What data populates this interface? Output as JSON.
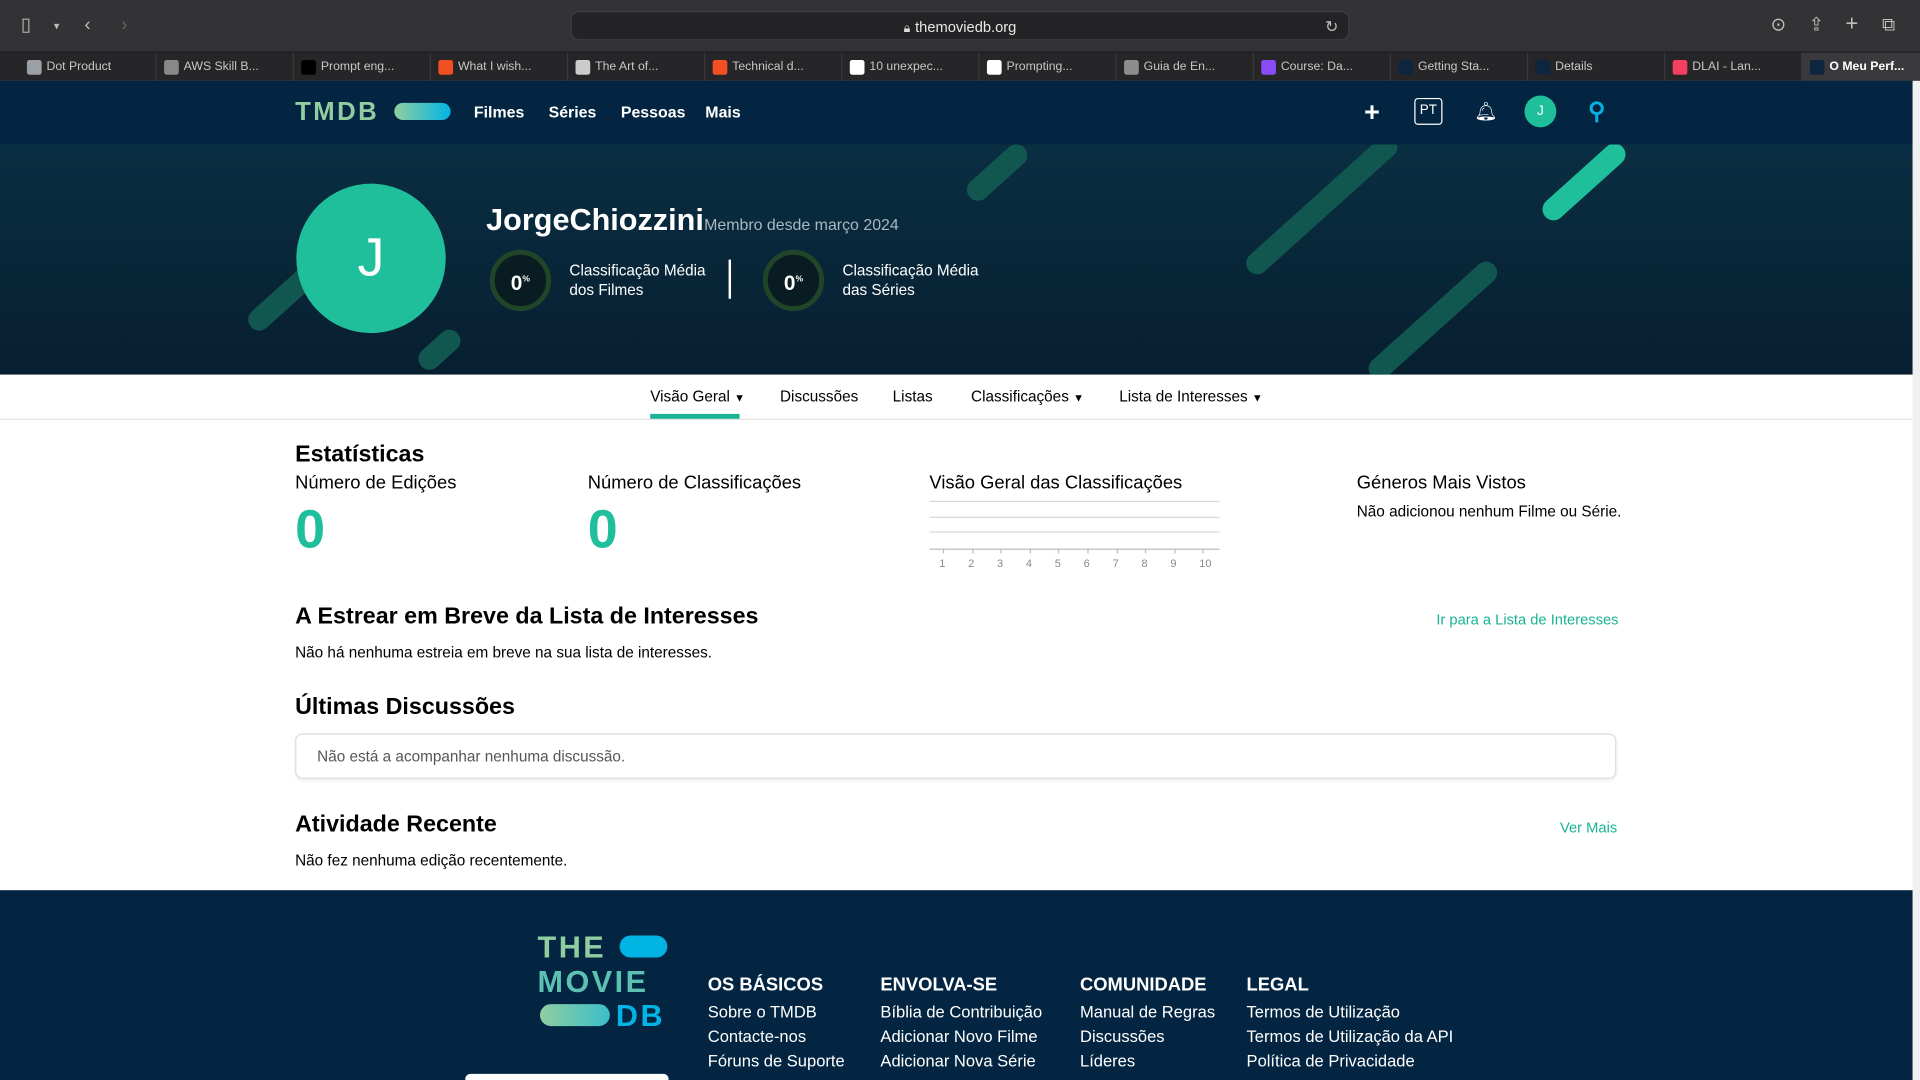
{
  "browser": {
    "url": "themoviedb.org",
    "tabs": [
      {
        "label": "Dot Product",
        "color": "#9aa0a6"
      },
      {
        "label": "AWS Skill B...",
        "color": "#888888"
      },
      {
        "label": "Prompt eng...",
        "color": "#000000"
      },
      {
        "label": "What I wish...",
        "color": "#f25022"
      },
      {
        "label": "The Art of...",
        "color": "#cccccc"
      },
      {
        "label": "Technical d...",
        "color": "#f25022"
      },
      {
        "label": "10 unexpec...",
        "color": "#ffffff"
      },
      {
        "label": "Prompting...",
        "color": "#ffffff"
      },
      {
        "label": "Guia de En...",
        "color": "#8d8d8d"
      },
      {
        "label": "Course: Da...",
        "color": "#8a4cf7"
      },
      {
        "label": "Getting Sta...",
        "color": "#0d253f"
      },
      {
        "label": "Details",
        "color": "#0d253f"
      },
      {
        "label": "DLAI - Lan...",
        "color": "#f43f5e"
      },
      {
        "label": "O Meu Perf...",
        "color": "#0d253f"
      }
    ]
  },
  "header": {
    "logo": "TMDB",
    "nav": [
      "Filmes",
      "Séries",
      "Pessoas",
      "Mais"
    ],
    "lang": "PT",
    "avatar_letter": "J"
  },
  "profile": {
    "avatar_letter": "J",
    "username": "JorgeChiozzini",
    "member_since": "Membro desde março 2024",
    "movie_score": "0",
    "movie_score_label_1": "Classificação Média",
    "movie_score_label_2": "dos Filmes",
    "tv_score": "0",
    "tv_score_label_1": "Classificação Média",
    "tv_score_label_2": "das Séries",
    "percent": "%"
  },
  "subnav": [
    "Visão Geral",
    "Discussões",
    "Listas",
    "Classificações",
    "Lista de Interesses"
  ],
  "stats": {
    "title": "Estatísticas",
    "edits_label": "Número de Edições",
    "edits_value": "0",
    "ratings_label": "Número de Classificações",
    "ratings_value": "0",
    "overview_label": "Visão Geral das Classificações",
    "genres_label": "Géneros Mais Vistos",
    "genres_empty": "Não adicionou nenhum Filme ou Série."
  },
  "chart_data": {
    "type": "bar",
    "categories": [
      "1",
      "2",
      "3",
      "4",
      "5",
      "6",
      "7",
      "8",
      "9",
      "10"
    ],
    "values": [
      0,
      0,
      0,
      0,
      0,
      0,
      0,
      0,
      0,
      0
    ],
    "title": "Visão Geral das Classificações"
  },
  "upcoming": {
    "title": "A Estrear em Breve da Lista de Interesses",
    "link": "Ir para a Lista de Interesses",
    "empty": "Não há nenhuma estreia em breve na sua lista de interesses."
  },
  "discussions": {
    "title": "Últimas Discussões",
    "empty": "Não está a acompanhar nenhuma discussão."
  },
  "activity": {
    "title": "Atividade Recente",
    "link": "Ver Mais",
    "empty": "Não fez nenhuma edição recentemente."
  },
  "footer": {
    "logo_line1": "THE",
    "logo_line2": "MOVIE",
    "logo_line3": "DB",
    "columns": [
      {
        "title": "OS BÁSICOS",
        "links": [
          "Sobre o TMDB",
          "Contacte-nos",
          "Fóruns de Suporte"
        ]
      },
      {
        "title": "ENVOLVA-SE",
        "links": [
          "Bíblia de Contribuição",
          "Adicionar Novo Filme",
          "Adicionar Nova Série"
        ]
      },
      {
        "title": "COMUNIDADE",
        "links": [
          "Manual de Regras",
          "Discussões",
          "Líderes"
        ]
      },
      {
        "title": "LEGAL",
        "links": [
          "Termos de Utilização",
          "Termos de Utilização da API",
          "Política de Privacidade"
        ]
      }
    ]
  },
  "colors": {
    "brand_dark": "#032541",
    "accent": "#1fbf9c",
    "link": "#1ab394"
  }
}
